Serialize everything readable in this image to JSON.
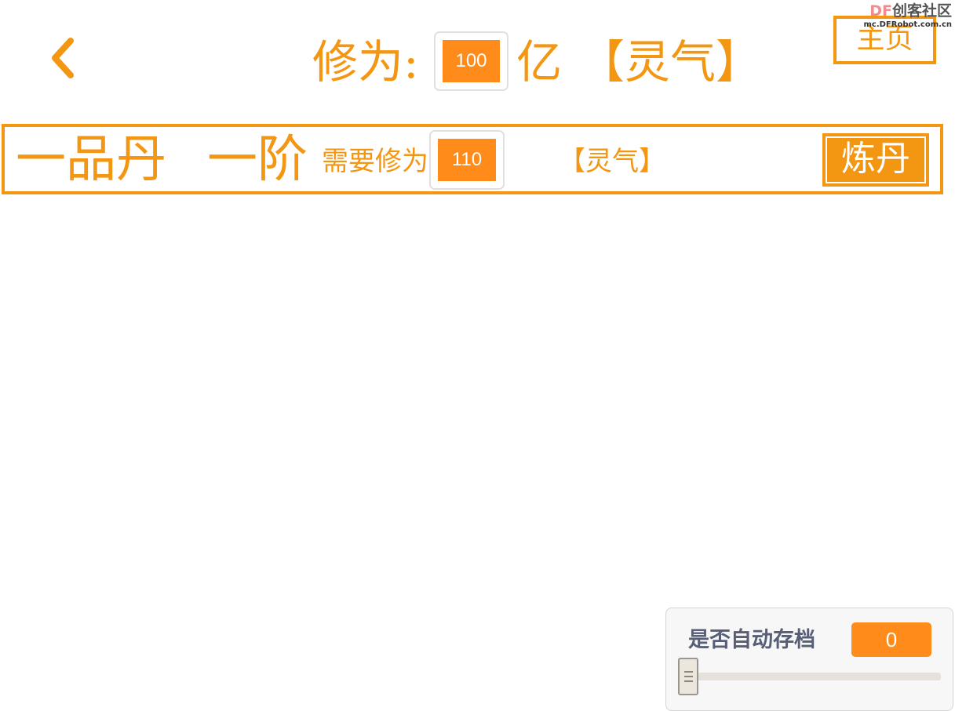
{
  "watermark": {
    "brand_df": "DF",
    "brand_name": "创客社区",
    "url": "mc.DFRobot.com.cn"
  },
  "header": {
    "back_icon": "chevron-left-icon",
    "cultivation_label": "修为:",
    "cultivation_value": "100",
    "cultivation_unit": "亿",
    "energy_label": "【灵气】",
    "home_label": "主页"
  },
  "pill_row": {
    "name": "一品丹",
    "rank": "一阶",
    "require_label": "需要修为",
    "require_value": "110",
    "energy_label": "【灵气】",
    "refine_label": "炼丹"
  },
  "autosave_monitor": {
    "label": "是否自动存档",
    "value": "0",
    "slider_level": 0
  },
  "colors": {
    "accent": "#f39612",
    "value_box": "#ff8c1a",
    "monitor_text": "#575e75"
  }
}
